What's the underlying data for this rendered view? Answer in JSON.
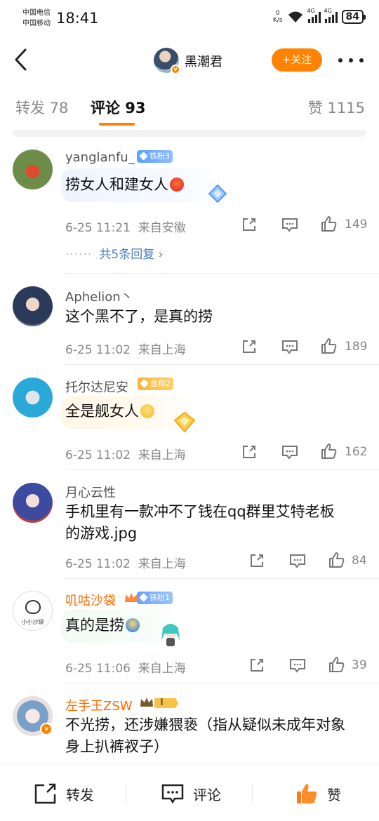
{
  "status_bar": {
    "carrier1": "中国电信",
    "carrier2": "中国移动",
    "time": "18:41",
    "net_speed_value": "0",
    "net_speed_unit": "K/s",
    "signal1_label": "4G",
    "signal2_label": "4G",
    "battery": "84"
  },
  "nav": {
    "title": "黑潮君",
    "follow_label": "+关注"
  },
  "tabs": [
    {
      "label": "转发 78"
    },
    {
      "label": "评论 93"
    },
    {
      "label": "赞 1115"
    }
  ],
  "comments": [
    {
      "user": "yanglanfu_",
      "badge": "铁粉3",
      "text": "捞女人和建女人",
      "time": "6-25 11:21",
      "location": "来自安徽",
      "likes": "149",
      "replies": "共5条回复"
    },
    {
      "user": "Aphelion丶",
      "text": "这个黑不了，是真的捞",
      "time": "6-25 11:02",
      "location": "来自上海",
      "likes": "189"
    },
    {
      "user": "托尔达尼安",
      "badge": "金粉2",
      "text": "全是舰女人",
      "time": "6-25 11:02",
      "location": "来自上海",
      "likes": "162"
    },
    {
      "user": "月心云性",
      "text_line1": "手机里有一款冲不了钱在qq群里艾特老板",
      "text_line2": "的游戏.jpg",
      "time": "6-25 11:02",
      "location": "来自上海",
      "likes": "84"
    },
    {
      "user": "叽咕沙袋",
      "badge": "铁粉1",
      "avatar_text": "小小沙袋",
      "text": "真的是捞",
      "time": "6-25 11:06",
      "location": "来自上海",
      "likes": "39"
    },
    {
      "user": "左手王ZSW",
      "vip_level": "I",
      "text_line1": "不光捞，还涉嫌猥亵（指从疑似未成年对象",
      "text_line2": "身上扒裤衩子）"
    }
  ],
  "bottom_bar": {
    "repost_label": "转发",
    "comment_label": "评论",
    "like_label": "赞"
  },
  "colors": {
    "accent": "#ff8200",
    "link": "#4a7fc1",
    "meta": "#888888"
  }
}
